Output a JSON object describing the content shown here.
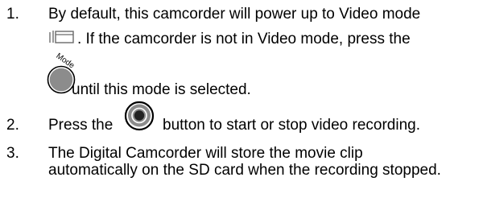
{
  "steps": [
    {
      "number": "1.",
      "lines": [
        "By default, this camcorder will power up to Video mode",
        ". If the camcorder is not in Video mode, press the",
        "until this mode is selected."
      ]
    },
    {
      "number": "2.",
      "before": "Press the",
      "after": "button to start or stop video recording."
    },
    {
      "number": "3.",
      "lines": [
        "The Digital Camcorder will store the movie clip",
        "automatically on the SD card when the recording stopped."
      ]
    }
  ],
  "icons": {
    "video_mode": "video-mode-icon",
    "mode_button": "mode-button-icon",
    "mode_button_label": "Mode",
    "record_button": "record-button-icon"
  }
}
